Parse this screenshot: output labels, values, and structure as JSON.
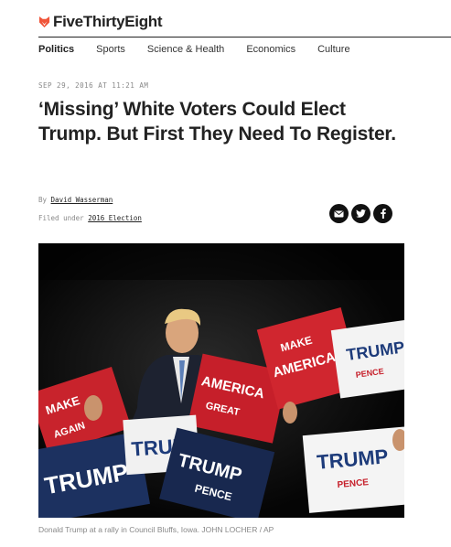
{
  "site": {
    "name": "FiveThirtyEight",
    "accent_color": "#f0553a"
  },
  "nav": {
    "items": [
      {
        "label": "Politics",
        "active": true
      },
      {
        "label": "Sports",
        "active": false
      },
      {
        "label": "Science & Health",
        "active": false
      },
      {
        "label": "Economics",
        "active": false
      },
      {
        "label": "Culture",
        "active": false
      }
    ]
  },
  "article": {
    "dateline": "SEP 29, 2016 AT 11:21 AM",
    "headline": "‘Missing’ White Voters Could Elect Trump. But First They Need To Register.",
    "byline_prefix": "By",
    "author": "David Wasserman",
    "filed_prefix": "Filed under",
    "filed_topic": "2016 Election"
  },
  "share": {
    "icons": [
      "email-icon",
      "twitter-icon",
      "facebook-icon"
    ]
  },
  "photo": {
    "caption": "Donald Trump at a rally in Council Bluffs, Iowa. JOHN LOCHER / AP",
    "sign_texts": {
      "trump": "TRUMP",
      "pence": "PENCE",
      "make": "MAKE",
      "america": "AMERICA",
      "great": "GREAT",
      "again": "AGAIN"
    }
  }
}
